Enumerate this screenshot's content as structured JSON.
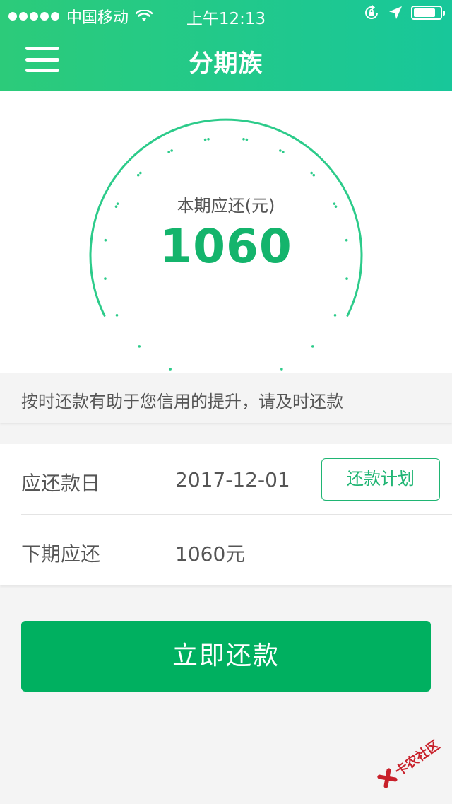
{
  "status_bar": {
    "carrier": "中国移动",
    "time": "上午12:13",
    "battery_level": 0.85
  },
  "nav": {
    "title": "分期族"
  },
  "gauge": {
    "label": "本期应还(元)",
    "amount": "1060"
  },
  "notice": {
    "text": "按时还款有助于您信用的提升，请及时还款"
  },
  "info": {
    "due_date_label": "应还款日",
    "due_date_value": "2017-12-01",
    "plan_button": "还款计划",
    "next_label": "下期应还",
    "next_value": "1060元"
  },
  "actions": {
    "pay_button": "立即还款"
  },
  "watermark": {
    "text": "卡农社区"
  },
  "colors": {
    "brand": "#1fc47f",
    "accent": "#00b060",
    "amount": "#14b46c"
  }
}
